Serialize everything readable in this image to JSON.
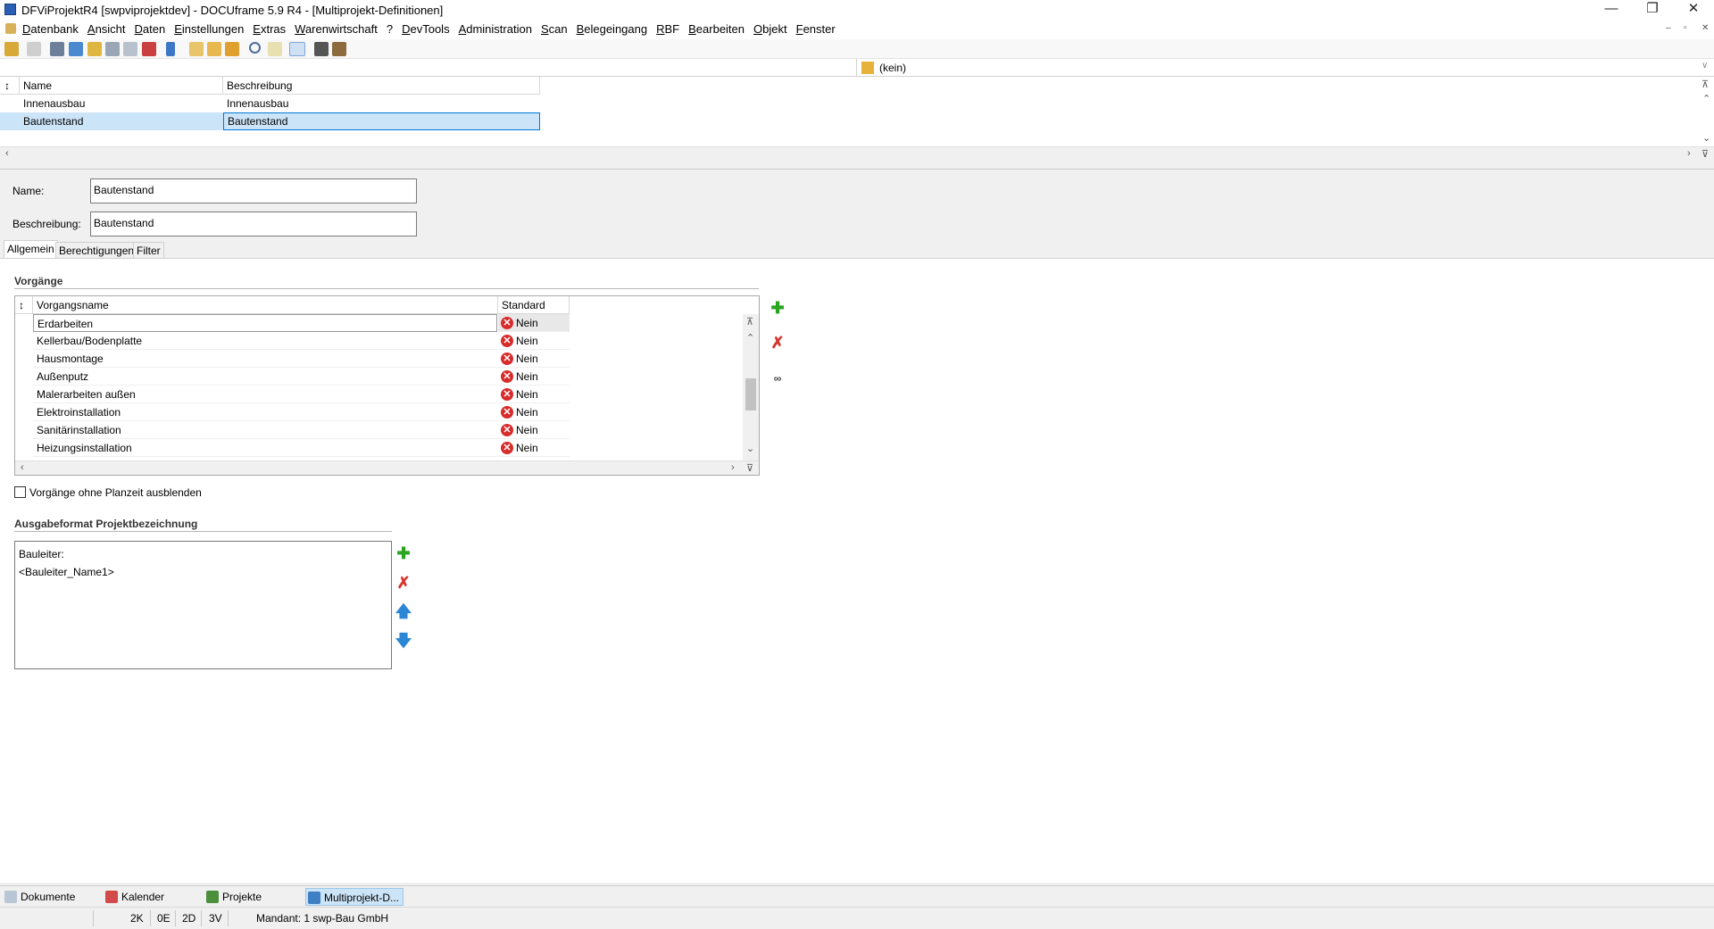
{
  "window": {
    "title": "DFViProjektR4 [swpviprojektdev] - DOCUframe 5.9 R4 - [Multiprojekt-Definitionen]"
  },
  "menu": [
    "Datenbank",
    "Ansicht",
    "Daten",
    "Einstellungen",
    "Extras",
    "Warenwirtschaft",
    "?",
    "DevTools",
    "Administration",
    "Scan",
    "Belegeingang",
    "RBF",
    "Bearbeiten",
    "Objekt",
    "Fenster"
  ],
  "filter": {
    "value": "(kein)"
  },
  "upper_grid": {
    "columns": [
      "Name",
      "Beschreibung"
    ],
    "rows": [
      {
        "name": "Innenausbau",
        "beschreibung": "Innenausbau"
      },
      {
        "name": "Bautenstand",
        "beschreibung": "Bautenstand"
      }
    ]
  },
  "form": {
    "name_label": "Name:",
    "name_value": "Bautenstand",
    "beschreibung_label": "Beschreibung:",
    "beschreibung_value": "Bautenstand"
  },
  "tabs": [
    "Allgemein",
    "Berechtigungen",
    "Filter"
  ],
  "vorgaenge": {
    "section_title": "Vorgänge",
    "columns": [
      "Vorgangsname",
      "Standard"
    ],
    "rows": [
      {
        "name": "Erdarbeiten",
        "standard": "Nein"
      },
      {
        "name": "Kellerbau/Bodenplatte",
        "standard": "Nein"
      },
      {
        "name": "Hausmontage",
        "standard": "Nein"
      },
      {
        "name": "Außenputz",
        "standard": "Nein"
      },
      {
        "name": "Malerarbeiten außen",
        "standard": "Nein"
      },
      {
        "name": "Elektroinstallation",
        "standard": "Nein"
      },
      {
        "name": "Sanitärinstallation",
        "standard": "Nein"
      },
      {
        "name": "Heizungsinstallation",
        "standard": "Nein"
      }
    ],
    "checkbox_label": "Vorgänge ohne Planzeit ausblenden"
  },
  "ausgabe": {
    "section_title": "Ausgabeformat Projektbezeichnung",
    "lines": [
      "Bauleiter:",
      "<Bauleiter_Name1>"
    ]
  },
  "doc_tabs": [
    "Dokumente",
    "Kalender",
    "Projekte",
    "Multiprojekt-D..."
  ],
  "status": {
    "k": "2K",
    "e": "0E",
    "d": "2D",
    "v": "3V",
    "mandant": "Mandant: 1 swp-Bau GmbH"
  }
}
